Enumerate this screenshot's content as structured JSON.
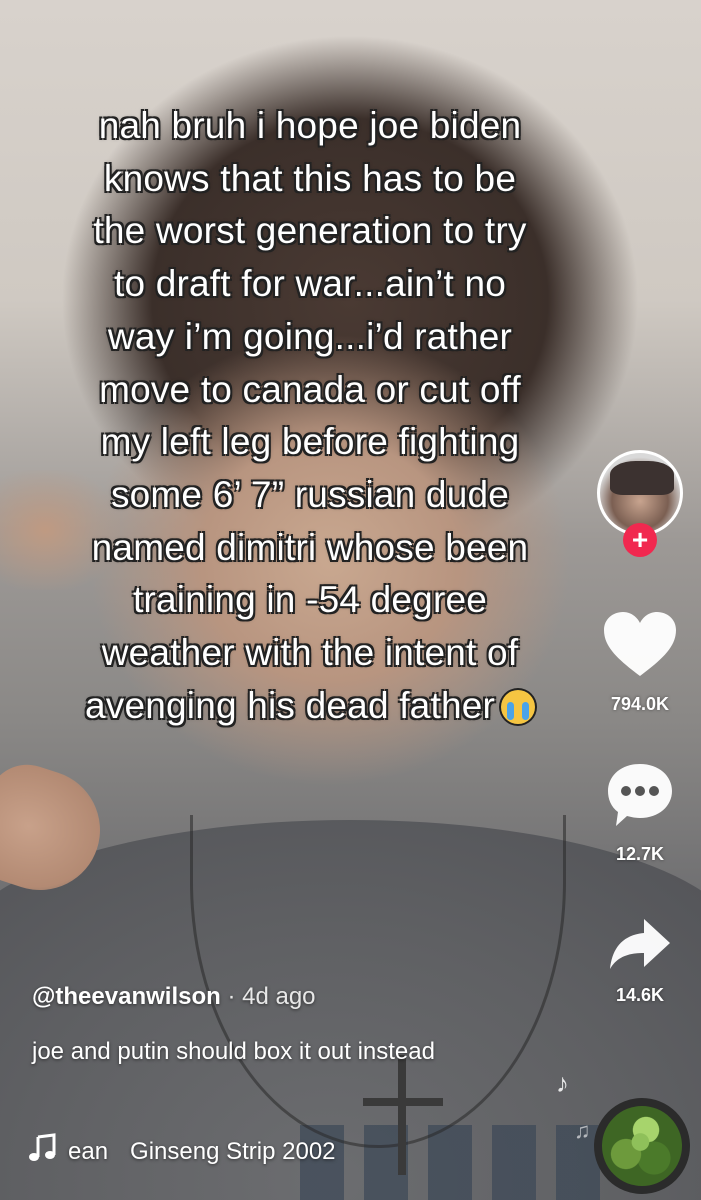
{
  "caption": {
    "lines": [
      "nah bruh i hope joe biden",
      "knows that this has to be",
      "the worst generation to try",
      "to draft for war...ain’t no",
      "way i’m going...i’d rather",
      "move to canada or cut off",
      "my left leg before fighting",
      "some 6’ 7” russian dude",
      "named dimitri whose been",
      "training in -54 degree",
      "weather with the intent of",
      "avenging his dead father"
    ],
    "emoji": "loudly-crying-face-emoji"
  },
  "rail": {
    "follow_symbol": "+",
    "likes": "794.0K",
    "comments": "12.7K",
    "shares": "14.6K",
    "like_color": "#ffffff",
    "follow_color": "#f1284f"
  },
  "post": {
    "username": "@theevanwilson",
    "time": " · 4d ago",
    "description": "joe and putin should box it out instead"
  },
  "music": {
    "fragment": "ean",
    "title": "Ginseng Strip 2002"
  }
}
